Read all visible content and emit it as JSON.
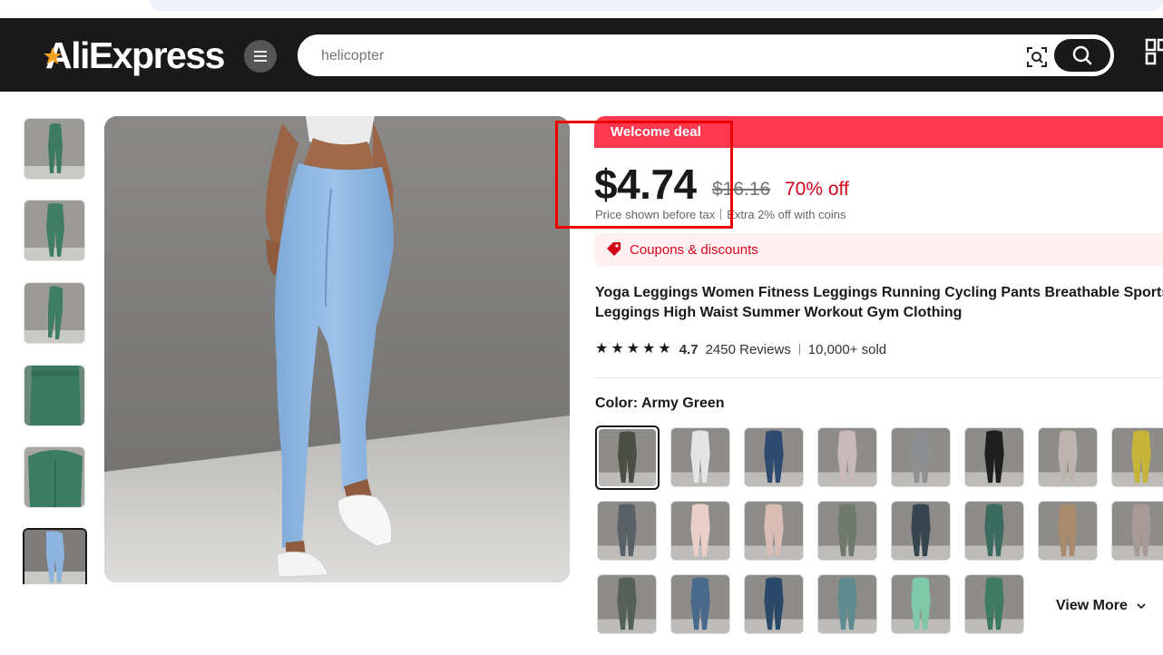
{
  "header": {
    "logo_text": "AliExpress",
    "search_placeholder": "helicopter"
  },
  "gallery": {
    "thumb_colors": [
      "#3e7a62",
      "#3f7d66",
      "#3f7d66",
      "#3a7a60",
      "#3c7c63",
      "#8db4df"
    ],
    "main_color": "#8fb8e0"
  },
  "product": {
    "deal_label": "Welcome deal",
    "price": "$4.74",
    "original_price": "$16.16",
    "discount": "70% off",
    "tax_note": "Price shown before tax",
    "coins_note": "Extra 2% off with coins",
    "coupons_label": "Coupons & discounts",
    "title_line1": "Yoga Leggings Women Fitness Leggings Running Cycling Pants Breathable Sports",
    "title_line2": "Leggings High Waist Summer Workout Gym Clothing",
    "rating": "4.7",
    "reviews": "2450 Reviews",
    "sold": "10,000+ sold",
    "color_label": "Color: ",
    "color_value": "Army Green",
    "view_more": "View More",
    "swatch_colors": [
      "#4b4e45",
      "#e4e4e4",
      "#2e4a6e",
      "#c9b8bc",
      "#8e8f90",
      "#1f1f1f",
      "#bdb3af",
      "#c7b43a",
      "#5a6165",
      "#e9cfc8",
      "#d9bcb4",
      "#6f7a6a",
      "#384650",
      "#3a6b5e",
      "#a88b6e",
      "#a89a96",
      "#56605a",
      "#4a6a8c",
      "#2a4868",
      "#5e8a90",
      "#7fc9a8",
      "#3e7a62"
    ]
  }
}
